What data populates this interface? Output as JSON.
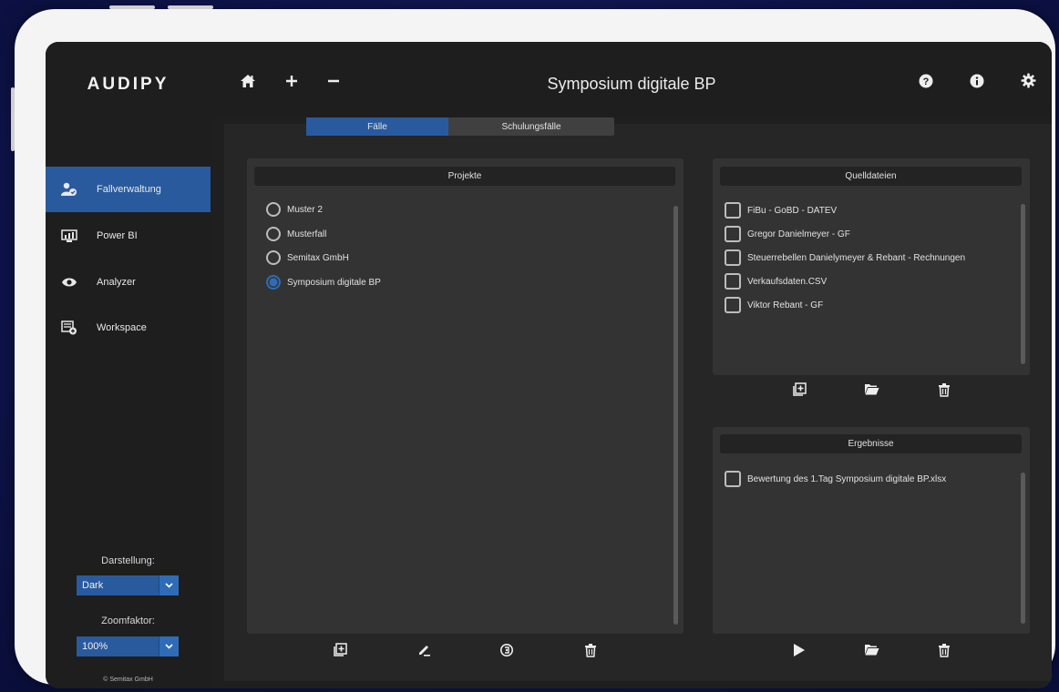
{
  "app": {
    "logo": "AUDIPY",
    "title": "Symposium digitale BP"
  },
  "sidebar": {
    "items": [
      {
        "label": "Fallverwaltung",
        "icon": "users-icon",
        "active": true
      },
      {
        "label": "Power BI",
        "icon": "chart-screen-icon",
        "active": false
      },
      {
        "label": "Analyzer",
        "icon": "eye-icon",
        "active": false
      },
      {
        "label": "Workspace",
        "icon": "workspace-icon",
        "active": false
      }
    ],
    "darstellung_label": "Darstellung:",
    "darstellung_value": "Dark",
    "zoom_label": "Zoomfaktor:",
    "zoom_value": "100%",
    "copyright": "© Semitax GmbH"
  },
  "toolbar": {
    "icons": [
      "home-icon",
      "plus-icon",
      "minus-icon",
      "help-icon",
      "info-icon",
      "gear-icon"
    ]
  },
  "tabs": [
    {
      "label": "Fälle",
      "active": true
    },
    {
      "label": "Schulungsfälle",
      "active": false
    }
  ],
  "projekte": {
    "header": "Projekte",
    "items": [
      {
        "label": "Muster 2",
        "selected": false
      },
      {
        "label": "Musterfall",
        "selected": false
      },
      {
        "label": "Semitax GmbH",
        "selected": false
      },
      {
        "label": "Symposium digitale BP",
        "selected": true
      }
    ],
    "actions": [
      "add-icon",
      "edit-icon",
      "refresh-icon",
      "delete-icon"
    ]
  },
  "quelldateien": {
    "header": "Quelldateien",
    "items": [
      {
        "label": "FiBu - GoBD - DATEV"
      },
      {
        "label": "Gregor Danielmeyer - GF"
      },
      {
        "label": "Steuerrebellen Danielymeyer & Rebant - Rechnungen"
      },
      {
        "label": "Verkaufsdaten.CSV"
      },
      {
        "label": "Viktor Rebant - GF"
      }
    ],
    "actions": [
      "add-icon",
      "folder-icon",
      "delete-icon"
    ]
  },
  "ergebnisse": {
    "header": "Ergebnisse",
    "items": [
      {
        "label": "Bewertung des 1.Tag Symposium digitale BP.xlsx"
      }
    ],
    "actions": [
      "play-icon",
      "folder-icon",
      "delete-icon"
    ]
  },
  "colors": {
    "accent": "#2a5a9e",
    "background": "#1e1e1e",
    "panel": "#333333"
  }
}
